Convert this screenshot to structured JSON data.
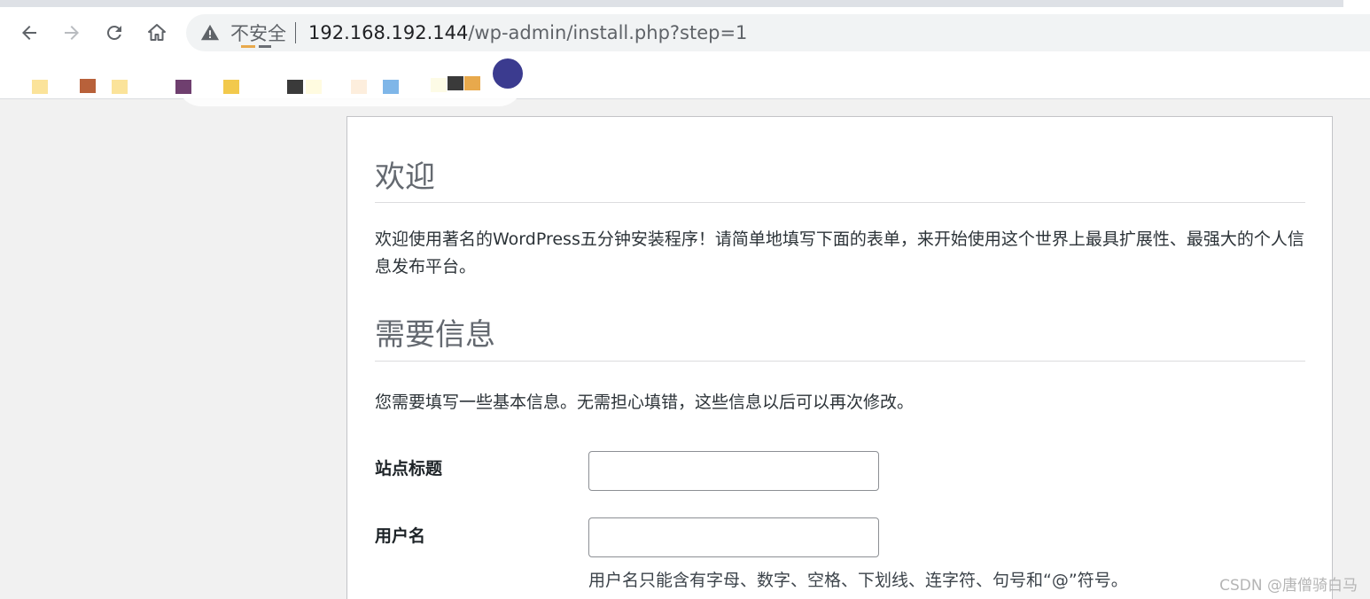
{
  "browser": {
    "security_label": "不安全",
    "url_host": "192.168.192.144",
    "url_path": "/wp-admin/install.php?step=1",
    "colors": {
      "chrome_bg": "#ffffff",
      "omnibox_bg": "#f1f3f4",
      "icon": "#5f6368"
    },
    "icons": [
      "back-icon",
      "forward-icon",
      "reload-icon",
      "home-icon",
      "warning-icon"
    ]
  },
  "bookmarks": {
    "colors": [
      "#fbe39a",
      "#b8613a",
      "#fbe39a",
      "#6f3f6f",
      "#f2c94c",
      "#3a3a3a",
      "#fffbe0",
      "#fdeedd",
      "#7fb6e8",
      "#fdfbe6",
      "#3a3a3a",
      "#e8a94c",
      "#3b3b8f"
    ]
  },
  "install": {
    "welcome_heading": "欢迎",
    "welcome_text": "欢迎使用著名的WordPress五分钟安装程序！请简单地填写下面的表单，来开始使用这个世界上最具扩展性、最强大的个人信息发布平台。",
    "required_heading": "需要信息",
    "required_text": "您需要填写一些基本信息。无需担心填错，这些信息以后可以再次修改。",
    "fields": [
      {
        "label": "站点标题",
        "value": ""
      },
      {
        "label": "用户名",
        "value": "",
        "hint": "用户名只能含有字母、数字、空格、下划线、连字符、句号和“@”符号。"
      }
    ]
  },
  "watermark": "CSDN @唐僧骑白马"
}
